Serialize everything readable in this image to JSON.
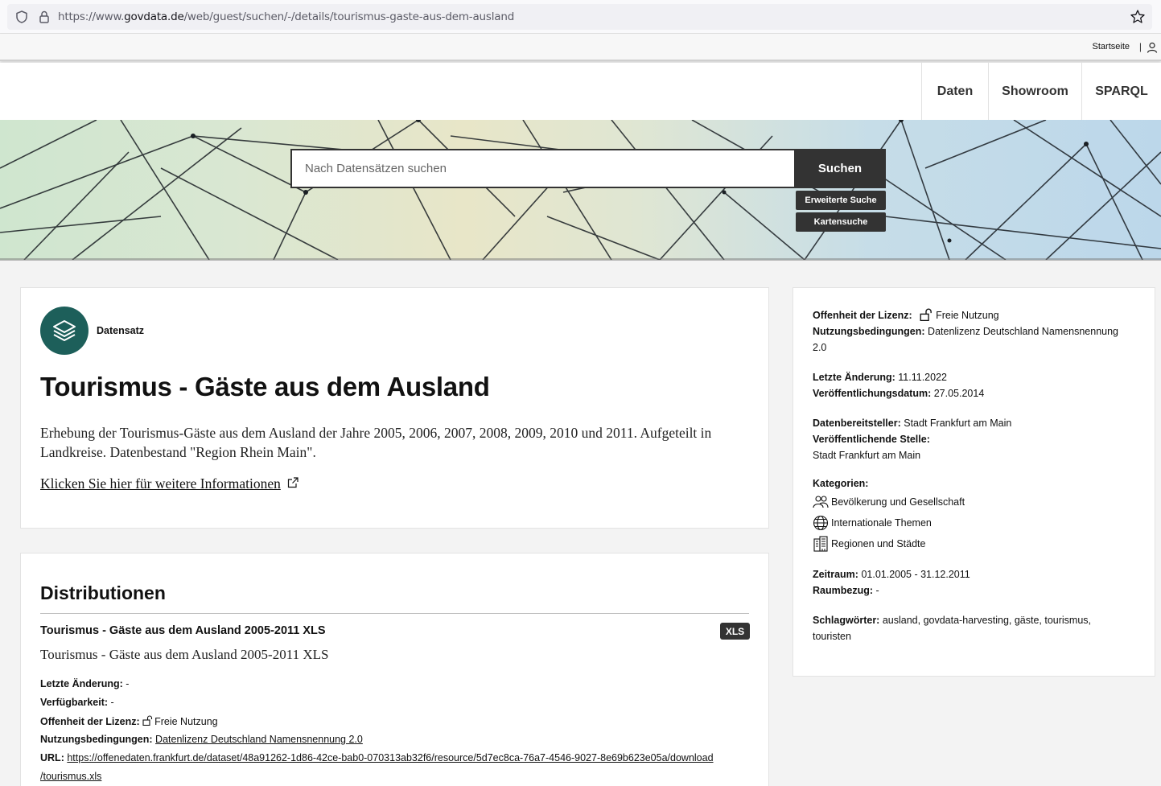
{
  "browser": {
    "url_prefix": "https://www.",
    "url_domain": "govdata.de",
    "url_path": "/web/guest/suchen/-/details/tourismus-gaste-aus-dem-ausland"
  },
  "utilbar": {
    "home_label": "Startseite",
    "separator": "|"
  },
  "nav": {
    "items": [
      "Daten",
      "Showroom",
      "SPARQL"
    ]
  },
  "search": {
    "placeholder": "Nach Datensätzen suchen",
    "button_label": "Suchen",
    "advanced_label": "Erweiterte Suche",
    "map_label": "Kartensuche"
  },
  "dataset": {
    "type_label": "Datensatz",
    "title": "Tourismus - Gäste aus dem Ausland",
    "description": "Erhebung der Tourismus-Gäste aus dem Ausland der Jahre 2005, 2006, 2007, 2008, 2009, 2010 und 2011. Aufgeteilt in Landkreise. Datenbestand \"Region Rhein Main\".",
    "more_info_link": "Klicken Sie hier für weitere Informationen"
  },
  "distributions": {
    "heading": "Distributionen",
    "items": [
      {
        "title": "Tourismus - Gäste aus dem Ausland 2005-2011 XLS",
        "format": "XLS",
        "subtitle": "Tourismus - Gäste aus dem Ausland 2005-2011 XLS",
        "last_change_label": "Letzte Änderung:",
        "last_change_value": "-",
        "availability_label": "Verfügbarkeit:",
        "availability_value": "-",
        "license_openness_label": "Offenheit der Lizenz:",
        "license_openness_value": "Freie Nutzung",
        "terms_label": "Nutzungsbedingungen:",
        "terms_value": "Datenlizenz Deutschland Namensnennung 2.0",
        "url_label": "URL:",
        "url_line1": "https://offenedaten.frankfurt.de/dataset/48a91262-1d86-42ce-bab0-070313ab32f6/resource/5d7ec8ca-76a7-4546-9027-8e69b623e05a/download",
        "url_line2": "/tourismus.xls"
      }
    ]
  },
  "meta": {
    "license_openness_label": "Offenheit der Lizenz:",
    "license_openness_value": "Freie Nutzung",
    "terms_label": "Nutzungsbedingungen:",
    "terms_value_1": "Datenlizenz Deutschland Namensnennung",
    "terms_value_2": "2.0",
    "last_change_label": "Letzte Änderung:",
    "last_change_value": "11.11.2022",
    "published_label": "Veröffentlichungsdatum:",
    "published_value": "27.05.2014",
    "provider_label": "Datenbereitsteller:",
    "provider_value": "Stadt Frankfurt am Main",
    "publisher_label": "Veröffentlichende Stelle:",
    "publisher_value": "Stadt Frankfurt am Main",
    "categories_label": "Kategorien:",
    "categories": [
      {
        "label": "Bevölkerung und Gesellschaft",
        "icon": "people-icon"
      },
      {
        "label": "Internationale Themen",
        "icon": "globe-icon"
      },
      {
        "label": "Regionen und Städte",
        "icon": "building-icon"
      }
    ],
    "period_label": "Zeitraum:",
    "period_value": "01.01.2005 - 31.12.2011",
    "spatial_label": "Raumbezug:",
    "spatial_value": "-",
    "keywords_label": "Schlagwörter:",
    "keywords_value_1": "ausland, govdata-harvesting, gäste, tourismus,",
    "keywords_value_2": "touristen"
  },
  "colors": {
    "accent": "#1d5f5a",
    "dark": "#333333"
  }
}
